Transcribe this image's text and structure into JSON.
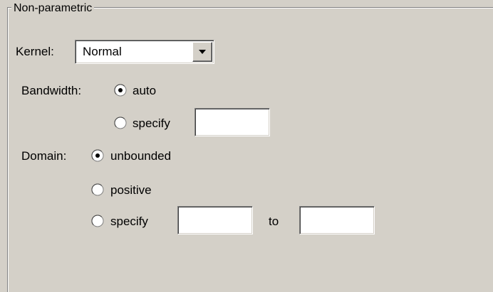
{
  "group": {
    "title": "Non-parametric"
  },
  "kernel": {
    "label": "Kernel:",
    "value": "Normal"
  },
  "bandwidth": {
    "label": "Bandwidth:",
    "options": [
      {
        "label": "auto",
        "selected": true
      },
      {
        "label": "specify",
        "selected": false
      }
    ],
    "specify_value": ""
  },
  "domain": {
    "label": "Domain:",
    "options": [
      {
        "label": "unbounded",
        "selected": true
      },
      {
        "label": "positive",
        "selected": false
      },
      {
        "label": "specify",
        "selected": false
      }
    ],
    "from_value": "",
    "to_label": "to",
    "to_value": ""
  },
  "colors": {
    "background": "#d4d0c8",
    "field_background": "#ffffff",
    "shadow": "#808080",
    "highlight": "#ffffff"
  },
  "icons": {
    "combo_arrow": "chevron-down-icon"
  }
}
